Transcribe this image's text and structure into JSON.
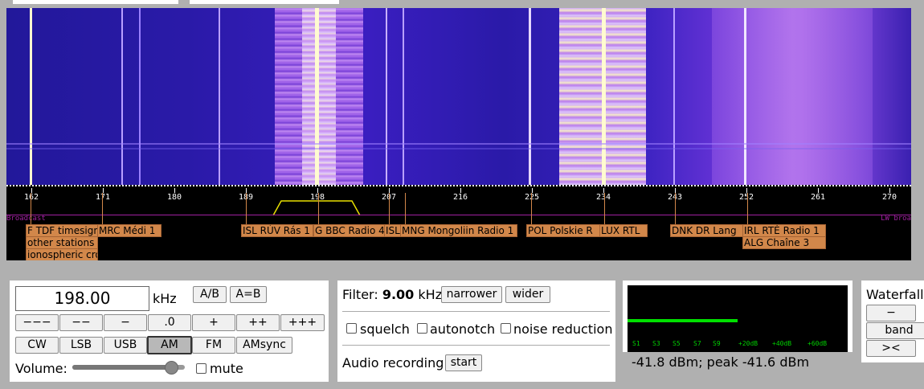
{
  "scale": {
    "ticks": [
      "162",
      "171",
      "180",
      "189",
      "198",
      "207",
      "216",
      "225",
      "234",
      "243",
      "252",
      "261",
      "270"
    ]
  },
  "band": {
    "left": "Broadcast",
    "right": "LW broa"
  },
  "stations": [
    {
      "label": "F TDF timesignal",
      "extra": [
        "other stations a",
        "ionospheric cro"
      ]
    },
    {
      "label": "MRC Médi 1"
    },
    {
      "label": "ISL RÚV Rás 1"
    },
    {
      "label": "G BBC Radio 4"
    },
    {
      "label": "ISL"
    },
    {
      "label": "MNG Mongoliin Radio 1"
    },
    {
      "label": "POL Polskie R"
    },
    {
      "label": "LUX RTL"
    },
    {
      "label": "DNK DR Lang"
    },
    {
      "label": "IRL RTÉ Radio 1",
      "extra": [
        "ALG Chaîne 3"
      ]
    }
  ],
  "tuning": {
    "frequency": "198.00",
    "unit": "kHz",
    "ab": "A/B",
    "aeqb": "A=B",
    "steps": [
      "−−−",
      "−−",
      "−",
      ".0",
      "+",
      "++",
      "+++"
    ],
    "modes": [
      "CW",
      "LSB",
      "USB",
      "AM",
      "FM",
      "AMsync"
    ],
    "active_mode": "AM",
    "volume_label": "Volume:",
    "mute_label": "mute",
    "volume_level": 0.88
  },
  "filter": {
    "label": "Filter:",
    "value": "9.00",
    "unit": "kHz",
    "narrower": "narrower",
    "wider": "wider",
    "squelch": "squelch",
    "autonotch": "autonotch",
    "noise_reduction": "noise reduction",
    "audio_recording": "Audio recording",
    "start": "start"
  },
  "smeter": {
    "scale": [
      "S1",
      "S3",
      "S5",
      "S7",
      "S9",
      "+20dB",
      "+40dB",
      "+60dB"
    ],
    "reading": "-41.8 dBm; peak  -41.6 dBm",
    "level": 0.5
  },
  "waterfall_panel": {
    "title": "Waterfall",
    "minus": "−",
    "band": "band",
    "prev": ">&lt;"
  }
}
